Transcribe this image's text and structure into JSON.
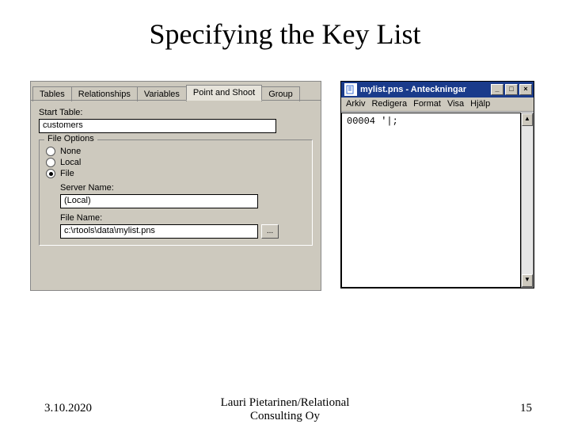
{
  "title": "Specifying the Key List",
  "footer": {
    "date": "3.10.2020",
    "center": "Lauri Pietarinen/Relational\nConsulting Oy",
    "page": "15"
  },
  "dialog": {
    "tabs": [
      "Tables",
      "Relationships",
      "Variables",
      "Point and Shoot",
      "Group"
    ],
    "active_tab": 3,
    "start_table_label": "Start Table:",
    "start_table_value": "customers",
    "file_options": {
      "legend": "File Options",
      "radios": [
        "None",
        "Local",
        "File"
      ],
      "selected": 2,
      "server_label": "Server Name:",
      "server_value": "(Local)",
      "file_label": "File Name:",
      "file_value": "c:\\rtools\\data\\mylist.pns",
      "browse": "..."
    }
  },
  "notepad": {
    "title": "mylist.pns - Anteckningar",
    "menus": [
      "Arkiv",
      "Redigera",
      "Format",
      "Visa",
      "Hjälp"
    ],
    "content": "00004 '|;",
    "scroll_up": "▲",
    "scroll_down": "▼",
    "btn_min": "_",
    "btn_max": "□",
    "btn_close": "×"
  }
}
